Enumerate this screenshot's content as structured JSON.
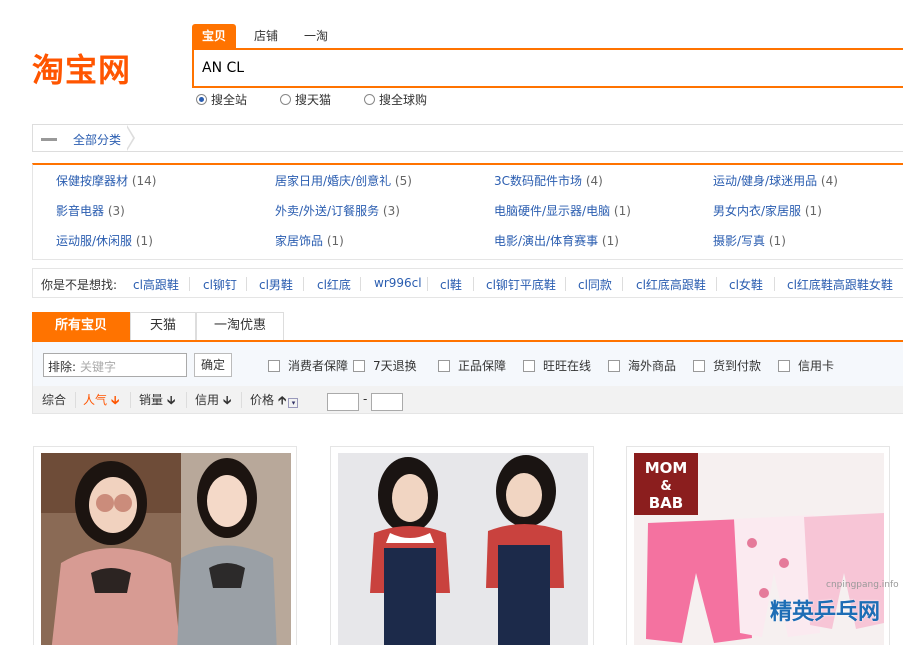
{
  "logo": {
    "text": "淘宝网"
  },
  "search": {
    "tabs": [
      "宝贝",
      "店铺",
      "一淘"
    ],
    "query": "AN CL",
    "scopes": [
      "搜全站",
      "搜天猫",
      "搜全球购"
    ],
    "selected_scope": "搜全站"
  },
  "breadcrumb": {
    "label": "全部分类"
  },
  "categories": [
    {
      "name": "保健按摩器材",
      "count": "(14)"
    },
    {
      "name": "居家日用/婚庆/创意礼",
      "count": "(5)"
    },
    {
      "name": "3C数码配件市场",
      "count": "(4)"
    },
    {
      "name": "运动/健身/球迷用品",
      "count": "(4)"
    },
    {
      "name": "影音电器",
      "count": "(3)"
    },
    {
      "name": "外卖/外送/订餐服务",
      "count": "(3)"
    },
    {
      "name": "电脑硬件/显示器/电脑",
      "count": "(1)"
    },
    {
      "name": "男女内衣/家居服",
      "count": "(1)"
    },
    {
      "name": "运动服/休闲服",
      "count": "(1)"
    },
    {
      "name": "家居饰品",
      "count": "(1)"
    },
    {
      "name": "电影/演出/体育赛事",
      "count": "(1)"
    },
    {
      "name": "摄影/写真",
      "count": "(1)"
    }
  ],
  "suggestions": {
    "label": "你是不是想找:",
    "items": [
      "cl高跟鞋",
      "cl铆钉",
      "cl男鞋",
      "cl红底",
      "wr996cl",
      "cl鞋",
      "cl铆钉平底鞋",
      "cl同款",
      "cl红底高跟鞋",
      "cl女鞋",
      "cl红底鞋高跟鞋女鞋"
    ]
  },
  "result_tabs": [
    "所有宝贝",
    "天猫",
    "一淘优惠"
  ],
  "filters": {
    "exclude_label": "排除:",
    "exclude_placeholder": "关键字",
    "confirm_label": "确定",
    "checkboxes": [
      "消费者保障",
      "7天退换",
      "正品保障",
      "旺旺在线",
      "海外商品",
      "货到付款",
      "信用卡"
    ]
  },
  "sort": {
    "items": [
      "综合",
      "人气",
      "销量",
      "信用",
      "价格"
    ],
    "active": "人气",
    "price_dash": "-"
  },
  "products": [
    {
      "image": "two girls in pink and grey sweaters with sunglasses"
    },
    {
      "image": "girl in red plaid shirt and denim overalls"
    },
    {
      "image": "MOM & BAB pink baby pants",
      "brand_line1": "MOM",
      "brand_line2": "&",
      "brand_line3": "BAB"
    }
  ],
  "watermark": {
    "text": "精英乒乓网",
    "url": "cnpingpang.info"
  },
  "colors": {
    "accent": "#ff7300",
    "link": "#2a5db0",
    "logo": "#ff5500"
  }
}
